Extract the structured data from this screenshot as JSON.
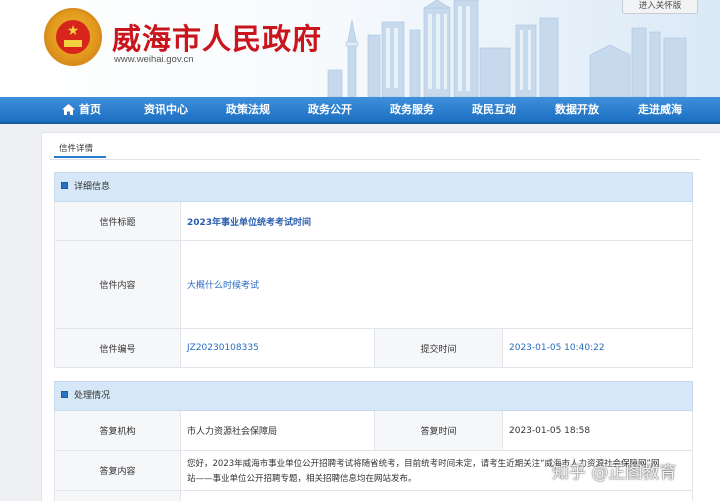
{
  "header": {
    "site_title": "威海市人民政府",
    "site_url": "www.weihai.gov.cn",
    "care_mode": "进入关怀版"
  },
  "nav": {
    "items": [
      "首页",
      "资讯中心",
      "政策法规",
      "政务公开",
      "政务服务",
      "政民互动",
      "数据开放",
      "走进威海"
    ]
  },
  "tab": {
    "label": "信件详情"
  },
  "detail": {
    "section_title": "详细信息",
    "letter_title_label": "信件标题",
    "letter_title_value": "2023年事业单位统考考试时间",
    "letter_content_label": "信件内容",
    "letter_content_value": "大概什么时候考试",
    "letter_number_label": "信件编号",
    "letter_number_value": "JZ20230108335",
    "submit_time_label": "提交时间",
    "submit_time_value": "2023-01-05 10:40:22"
  },
  "handling": {
    "section_title": "处理情况",
    "org_label": "答复机构",
    "org_value": "市人力资源社会保障局",
    "reply_time_label": "答复时间",
    "reply_time_value": "2023-01-05 18:58",
    "reply_content_label": "答复内容",
    "reply_content_line1": "您好，2023年威海市事业单位公开招聘考试将随省统考，目前统考时间未定，请考生近期关注“威海市人力资源社会保障网”网",
    "reply_content_line2": "站——事业单位公开招聘专题，相关招聘信息均在网站发布。"
  },
  "watermark": "知乎 @正图教育",
  "colors": {
    "nav_blue": "#2a7bd0",
    "title_red": "#c9161d",
    "section_bg": "#d6e8f7",
    "link_blue": "#2a6bc2"
  }
}
